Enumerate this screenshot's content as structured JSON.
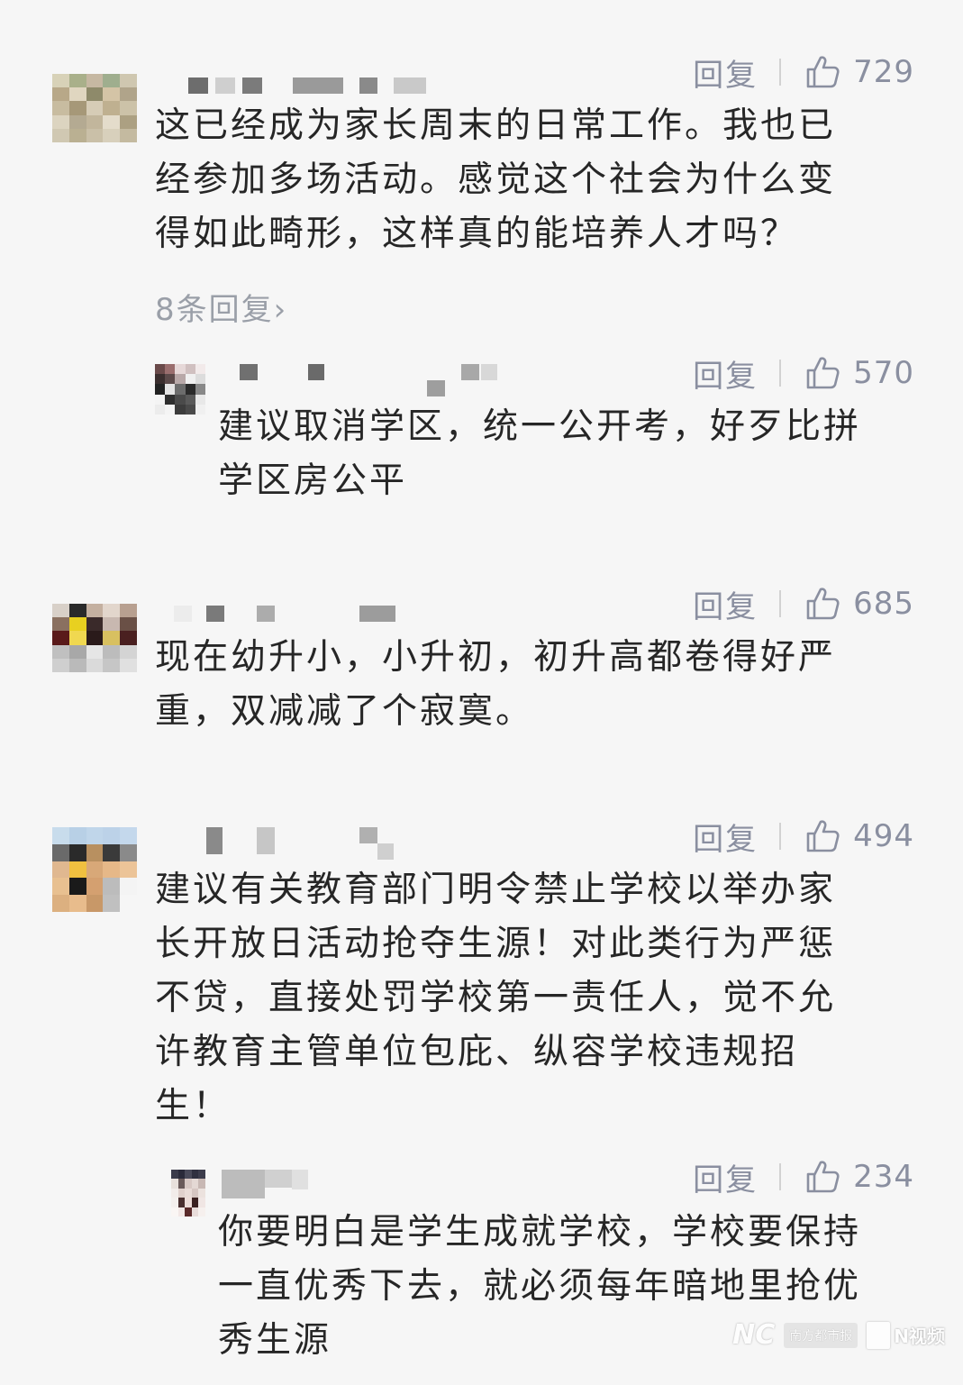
{
  "comments": [
    {
      "reply_label": "回复",
      "likes": "729",
      "text_lines": [
        "这已经成为家长周末的日常工作。我也已",
        "经参加多场活动。感觉这个社会为什么变",
        "得如此畸形，这样真的能培养人才吗？"
      ],
      "more_replies": "8条回复›",
      "reply": {
        "reply_label": "回复",
        "likes": "570",
        "text_lines": [
          "建议取消学区，统一公开考，好歹比拼",
          "学区房公平"
        ]
      }
    },
    {
      "reply_label": "回复",
      "likes": "685",
      "text_lines": [
        "现在幼升小，小升初，初升高都卷得好严",
        "重，双减减了个寂寞。"
      ]
    },
    {
      "reply_label": "回复",
      "likes": "494",
      "text_lines": [
        "建议有关教育部门明令禁止学校以举办家",
        "长开放日活动抢夺生源！对此类行为严惩",
        "不贷，直接处罚学校第一责任人，觉不允",
        "许教育主管单位包庇、纵容学校违规招",
        "生！"
      ],
      "reply": {
        "reply_label": "回复",
        "likes": "234",
        "text_lines": [
          "你要明白是学生成就学校，学校要保持",
          "一直优秀下去，就必须每年暗地里抢优",
          "秀生源"
        ]
      }
    }
  ],
  "watermark": {
    "brand": "NC",
    "badge": "南方都市报",
    "video": "N视频"
  },
  "colors": {
    "background": "#f6f6f6",
    "text": "#262626",
    "meta": "#8a8fa0",
    "more": "#9a9fa8"
  },
  "icons": [
    "thumbs-up-icon",
    "avatar-image"
  ]
}
